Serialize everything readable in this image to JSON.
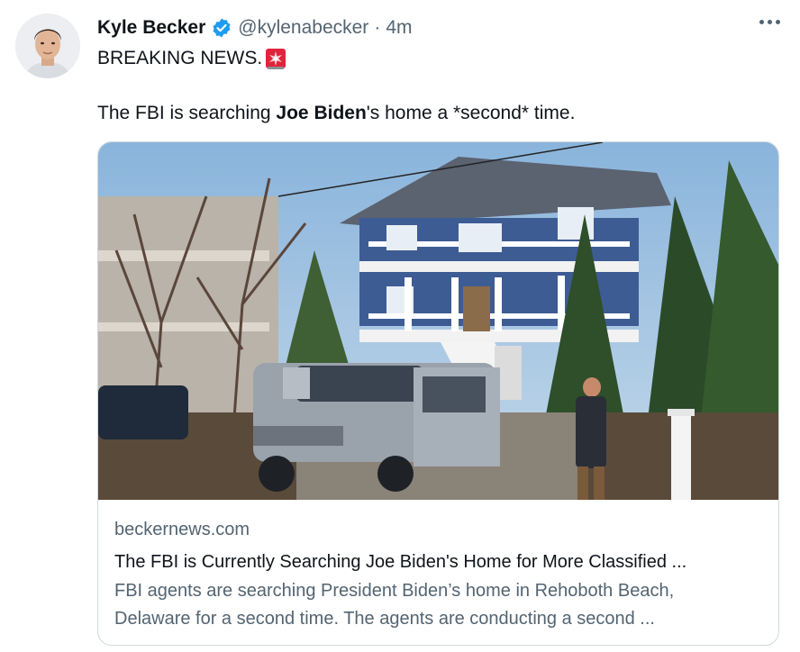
{
  "tweet": {
    "author_name": "Kyle Becker",
    "handle": "@kylenabecker",
    "separator": "·",
    "time": "4m",
    "line1": "BREAKING NEWS.",
    "line2_before": "The FBI is searching ",
    "line2_bold": "Joe Biden",
    "line2_after": "'s home a *second* time.",
    "icons": {
      "verified": "verified-badge-icon",
      "siren": "rotating-light-emoji-icon",
      "more": "more-options-icon"
    },
    "colors": {
      "verified_blue": "#1d9bf0",
      "secondary_text": "#536471",
      "siren_red": "#e0243b"
    }
  },
  "card": {
    "domain": "beckernews.com",
    "title": "The FBI is Currently Searching Joe Biden's Home for More Classified ...",
    "description_line1": "FBI agents are searching President Biden’s home in Rehoboth Beach,",
    "description_line2": "Delaware for a second time. The agents are conducting a second ..."
  }
}
